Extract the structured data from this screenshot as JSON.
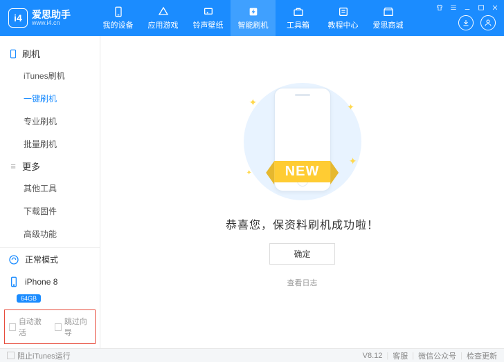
{
  "brand": {
    "name": "爱思助手",
    "url": "www.i4.cn",
    "logo_text": "i4"
  },
  "nav": [
    {
      "label": "我的设备",
      "icon": "phone"
    },
    {
      "label": "应用游戏",
      "icon": "apps"
    },
    {
      "label": "铃声壁纸",
      "icon": "music"
    },
    {
      "label": "智能刷机",
      "icon": "flash",
      "active": true
    },
    {
      "label": "工具箱",
      "icon": "toolbox"
    },
    {
      "label": "教程中心",
      "icon": "book"
    },
    {
      "label": "爱思商城",
      "icon": "shop"
    }
  ],
  "sidebar": {
    "sections": [
      {
        "title": "刷机",
        "items": [
          "iTunes刷机",
          "一键刷机",
          "专业刷机",
          "批量刷机"
        ],
        "active_index": 1
      },
      {
        "title": "更多",
        "items": [
          "其他工具",
          "下载固件",
          "高级功能"
        ]
      }
    ],
    "mode_label": "正常模式",
    "device_name": "iPhone 8",
    "device_storage": "64GB",
    "checkboxes": {
      "auto_activate": "自动激活",
      "skip_wizard": "跳过向导"
    }
  },
  "main": {
    "banner_text": "NEW",
    "success_text": "恭喜您，保资料刷机成功啦！",
    "confirm_label": "确定",
    "log_label": "查看日志"
  },
  "statusbar": {
    "block_itunes": "阻止iTunes运行",
    "version": "V8.12",
    "support": "客服",
    "wechat": "微信公众号",
    "check_update": "检查更新"
  }
}
